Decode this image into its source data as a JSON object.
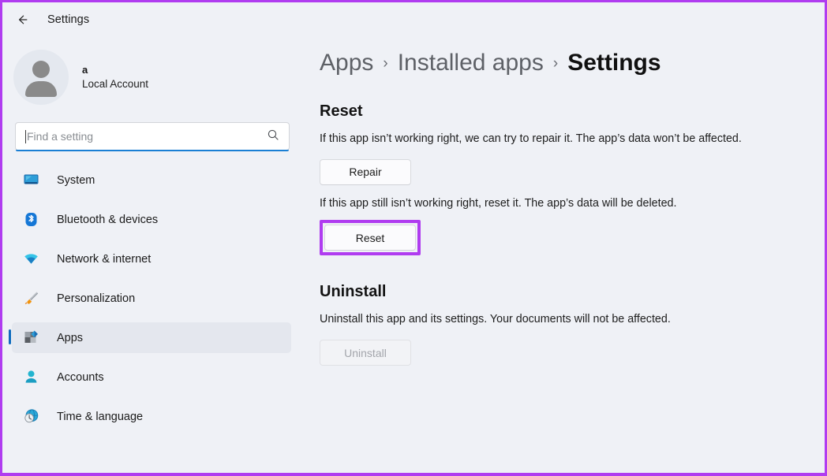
{
  "window": {
    "title": "Settings",
    "back_icon": "back-arrow-icon"
  },
  "accent_colors": {
    "annotation_purple": "#b03cf0",
    "focus_blue": "#1a7fd4",
    "selection_indicator_blue": "#0f6cbd",
    "page_background": "#eff1f6"
  },
  "sidebar": {
    "account": {
      "name": "a",
      "type": "Local Account",
      "avatar_icon": "user-avatar-icon"
    },
    "search": {
      "placeholder": "Find a setting",
      "value": "",
      "icon": "search-icon"
    },
    "items": [
      {
        "label": "System",
        "icon": "monitor-icon",
        "selected": false
      },
      {
        "label": "Bluetooth & devices",
        "icon": "bluetooth-icon",
        "selected": false
      },
      {
        "label": "Network & internet",
        "icon": "wifi-icon",
        "selected": false
      },
      {
        "label": "Personalization",
        "icon": "paintbrush-icon",
        "selected": false
      },
      {
        "label": "Apps",
        "icon": "apps-grid-icon",
        "selected": true
      },
      {
        "label": "Accounts",
        "icon": "person-icon",
        "selected": false
      },
      {
        "label": "Time & language",
        "icon": "clock-globe-icon",
        "selected": false
      }
    ]
  },
  "main": {
    "breadcrumb": {
      "items": [
        "Apps",
        "Installed apps"
      ],
      "separator": "›",
      "current": "Settings"
    },
    "reset_section": {
      "title": "Reset",
      "repair_description": "If this app isn’t working right, we can try to repair it. The app’s data won’t be affected.",
      "repair_button": "Repair",
      "reset_description": "If this app still isn’t working right, reset it. The app’s data will be deleted.",
      "reset_button": "Reset"
    },
    "uninstall_section": {
      "title": "Uninstall",
      "description": "Uninstall this app and its settings. Your documents will not be affected.",
      "button": "Uninstall",
      "button_disabled": true
    }
  }
}
